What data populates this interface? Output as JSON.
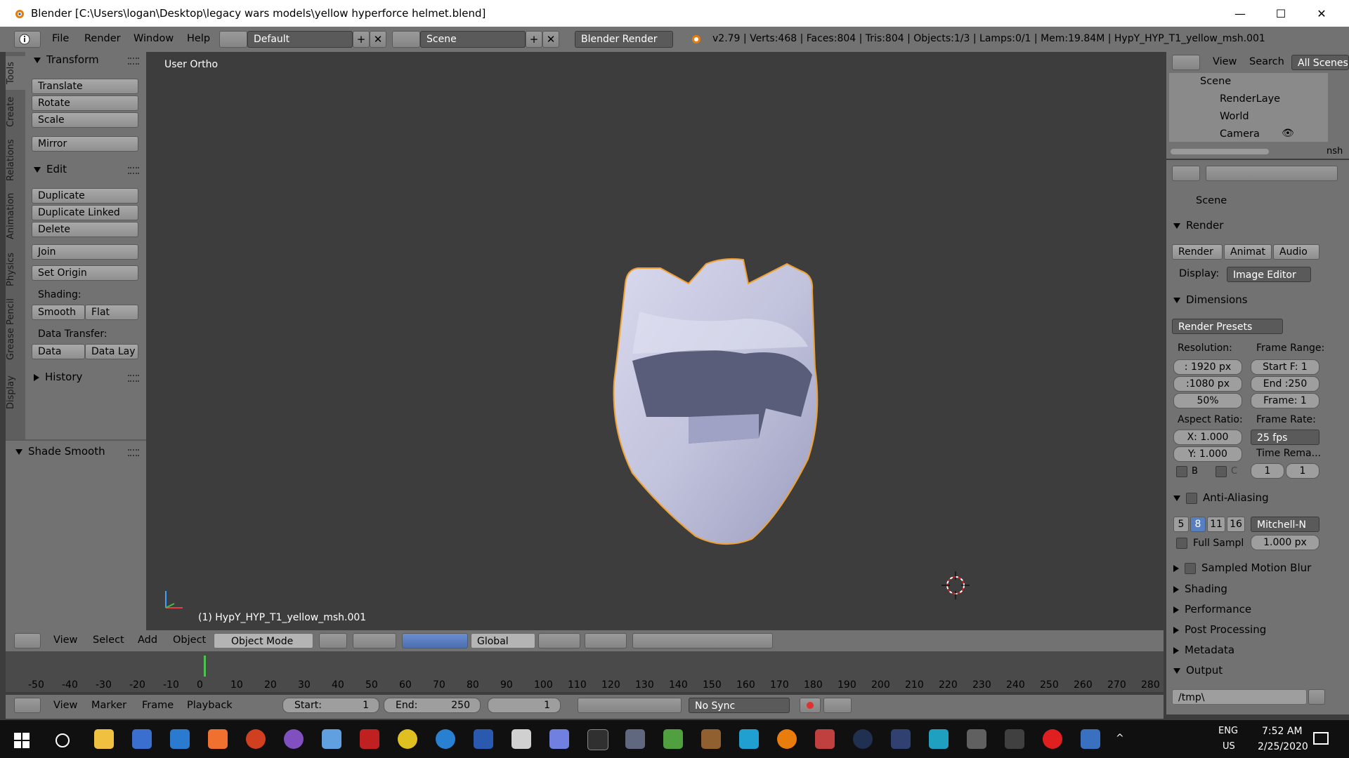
{
  "window": {
    "title": "Blender [C:\\Users\\logan\\Desktop\\legacy wars models\\yellow hyperforce helmet.blend]",
    "minimize": "—",
    "maximize": "☐",
    "close": "✕"
  },
  "topbar": {
    "menus": [
      "File",
      "Render",
      "Window",
      "Help"
    ],
    "layout": "Default",
    "scene": "Scene",
    "engine": "Blender Render",
    "stats": "v2.79 | Verts:468 | Faces:804 | Tris:804 | Objects:1/3 | Lamps:0/1 | Mem:19.84M | HypY_HYP_T1_yellow_msh.001"
  },
  "tabs": [
    "Tools",
    "Create",
    "Relations",
    "Animation",
    "Physics",
    "Grease Pencil",
    "Display"
  ],
  "toolpanel": {
    "transform_title": "Transform",
    "translate": "Translate",
    "rotate": "Rotate",
    "scale": "Scale",
    "mirror": "Mirror",
    "edit_title": "Edit",
    "duplicate": "Duplicate",
    "duplicate_linked": "Duplicate Linked",
    "delete": "Delete",
    "join": "Join",
    "set_origin": "Set Origin",
    "shading_label": "Shading:",
    "smooth": "Smooth",
    "flat": "Flat",
    "data_transfer_label": "Data Transfer:",
    "data": "Data",
    "data_lay": "Data Lay",
    "history": "History",
    "shade_smooth": "Shade Smooth"
  },
  "viewport": {
    "view_name": "User Ortho",
    "object_label": "(1) HypY_HYP_T1_yellow_msh.001"
  },
  "view_header": {
    "menus": [
      "View",
      "Select",
      "Add",
      "Object"
    ],
    "mode": "Object Mode",
    "orientation": "Global"
  },
  "timeline": {
    "ticks": [
      "-50",
      "-40",
      "-30",
      "-20",
      "-10",
      "0",
      "10",
      "20",
      "30",
      "40",
      "50",
      "60",
      "70",
      "80",
      "90",
      "100",
      "110",
      "120",
      "130",
      "140",
      "150",
      "160",
      "170",
      "180",
      "190",
      "200",
      "210",
      "220",
      "230",
      "240",
      "250",
      "260",
      "270",
      "280"
    ],
    "menus": [
      "View",
      "Marker",
      "Frame",
      "Playback"
    ],
    "start_label": "Start:",
    "start_value": "1",
    "end_label": "End:",
    "end_value": "250",
    "current": "1",
    "sync": "No Sync"
  },
  "outliner": {
    "view": "View",
    "search": "Search",
    "all_scenes": "All Scenes",
    "items": [
      "Scene",
      "RenderLaye",
      "World",
      "Camera"
    ],
    "scroll_tail": "nsh"
  },
  "properties": {
    "context": "Scene",
    "render_title": "Render",
    "render_btn": "Render",
    "animat_btn": "Animat",
    "audio_btn": "Audio",
    "display_label": "Display:",
    "display_value": "Image Editor",
    "dimensions_title": "Dimensions",
    "render_presets": "Render Presets",
    "resolution_label": "Resolution:",
    "frame_range_label": "Frame Range:",
    "res_x": ": 1920 px",
    "res_y": ":1080 px",
    "res_pct": "50%",
    "start_f": "Start F: 1",
    "end_f": "End :250",
    "frame": "Frame: 1",
    "aspect_label": "Aspect Ratio:",
    "frame_rate_label": "Frame Rate:",
    "aspect_x": "X:  1.000",
    "aspect_y": "Y:  1.000",
    "fps": "25 fps",
    "time_remap": "Time Rema...",
    "b_label": "B",
    "c_label": "C",
    "remap_old": "1",
    "remap_new": "1",
    "aa_title": "Anti-Aliasing",
    "aa_samples": [
      "5",
      "8",
      "11",
      "16"
    ],
    "aa_filter": "Mitchell-N",
    "full_sample": "Full Sampl",
    "filter_size": "1.000 px",
    "motion_blur": "Sampled Motion Blur",
    "shading": "Shading",
    "performance": "Performance",
    "post_processing": "Post Processing",
    "metadata": "Metadata",
    "output": "Output",
    "output_path": "/tmp\\"
  },
  "taskbar": {
    "time": "7:52 AM",
    "date": "2/25/2020",
    "lang1": "ENG",
    "lang2": "US"
  },
  "colors": {
    "panel": "#727272",
    "viewport": "#3d3d3d",
    "accent_blue": "#5680c2",
    "selection_orange": "#f0a030",
    "taskbar": "#101010"
  }
}
